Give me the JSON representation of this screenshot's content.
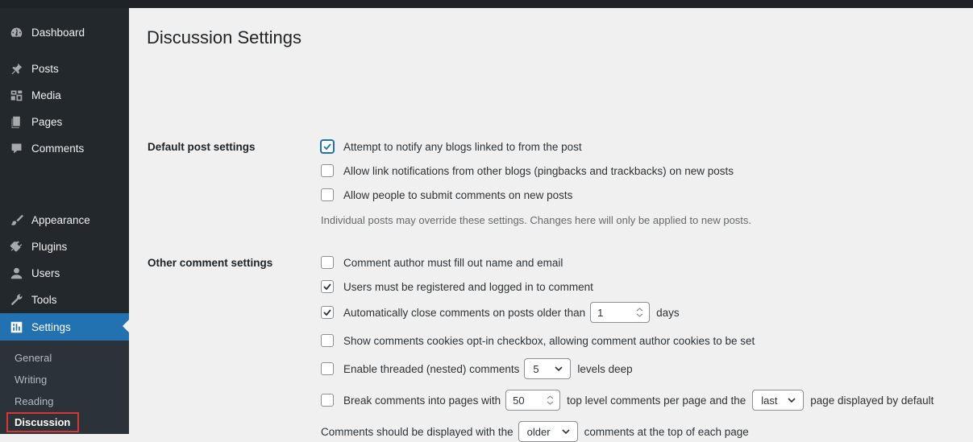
{
  "sidebar": {
    "items": [
      {
        "label": "Dashboard",
        "icon": "dashboard-icon"
      },
      {
        "label": "Posts",
        "icon": "pin-icon"
      },
      {
        "label": "Media",
        "icon": "media-icon"
      },
      {
        "label": "Pages",
        "icon": "pages-icon"
      },
      {
        "label": "Comments",
        "icon": "comments-icon"
      },
      {
        "label": "Appearance",
        "icon": "paintbrush-icon"
      },
      {
        "label": "Plugins",
        "icon": "plugin-icon"
      },
      {
        "label": "Users",
        "icon": "users-icon"
      },
      {
        "label": "Tools",
        "icon": "wrench-icon"
      },
      {
        "label": "Settings",
        "icon": "settings-icon"
      }
    ],
    "submenu": [
      "General",
      "Writing",
      "Reading",
      "Discussion"
    ]
  },
  "page": {
    "title": "Discussion Settings"
  },
  "default_post": {
    "label": "Default post settings",
    "options": [
      {
        "label": "Attempt to notify any blogs linked to from the post",
        "checked": true
      },
      {
        "label": "Allow link notifications from other blogs (pingbacks and trackbacks) on new posts",
        "checked": false
      },
      {
        "label": "Allow people to submit comments on new posts",
        "checked": false
      }
    ],
    "description": "Individual posts may override these settings. Changes here will only be applied to new posts."
  },
  "other_comment": {
    "label": "Other comment settings",
    "author_fill": {
      "label": "Comment author must fill out name and email",
      "checked": false
    },
    "registered": {
      "label": "Users must be registered and logged in to comment",
      "checked": true
    },
    "auto_close": {
      "prefix": "Automatically close comments on posts older than",
      "value": "1",
      "suffix": "days",
      "checked": true
    },
    "cookies": {
      "label": "Show comments cookies opt-in checkbox, allowing comment author cookies to be set",
      "checked": false
    },
    "threaded": {
      "prefix": "Enable threaded (nested) comments",
      "value": "5",
      "suffix": "levels deep",
      "checked": false
    },
    "paging": {
      "prefix": "Break comments into pages with",
      "per_page": "50",
      "middle": "top level comments per page and the",
      "page_select": "last",
      "suffix": "page displayed by default",
      "checked": false
    },
    "order": {
      "prefix": "Comments should be displayed with the",
      "value": "older",
      "suffix": "comments at the top of each page"
    }
  },
  "colors": {
    "accent": "#2271b1",
    "sidebar": "#23282d",
    "highlight_box": "#d63638"
  }
}
